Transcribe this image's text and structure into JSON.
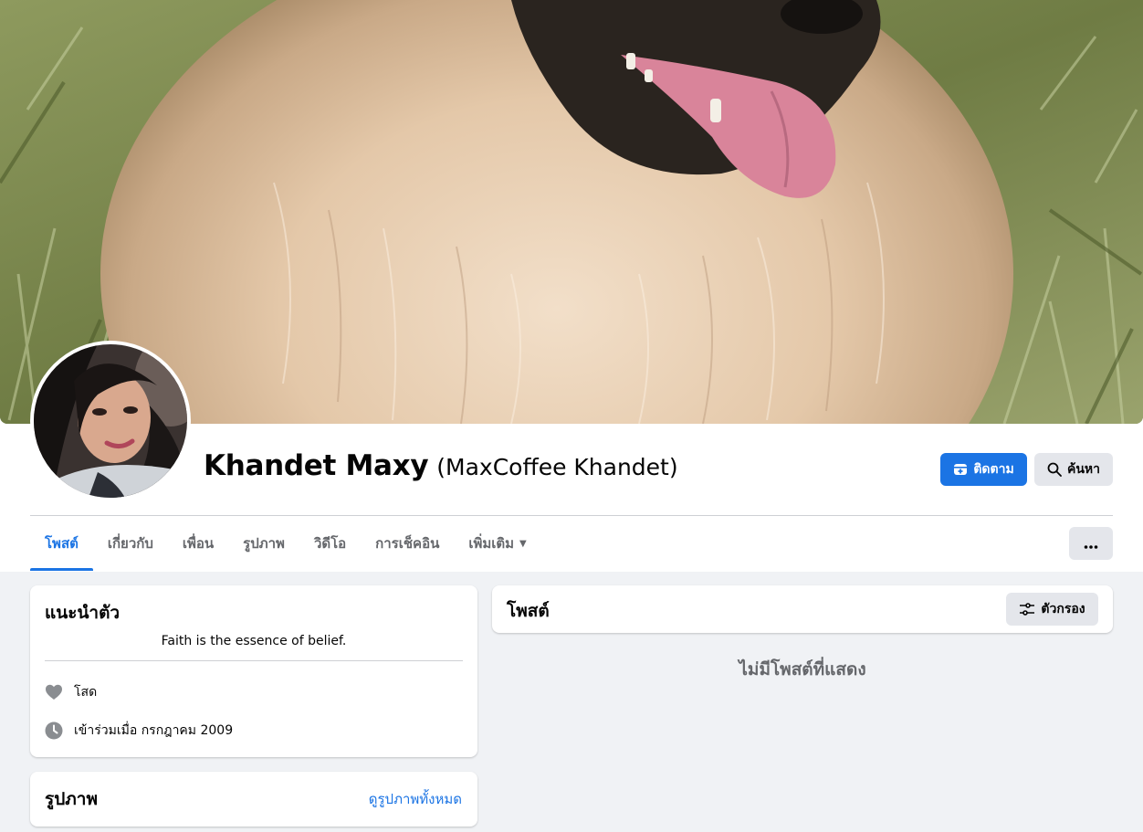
{
  "profile": {
    "name": "Khandet Maxy",
    "alternate_name": "(MaxCoffee Khandet)"
  },
  "header": {
    "follow_label": "ติดตาม",
    "search_label": "ค้นหา"
  },
  "tabs": [
    {
      "label": "โพสต์",
      "active": true
    },
    {
      "label": "เกี่ยวกับ"
    },
    {
      "label": "เพื่อน"
    },
    {
      "label": "รูปภาพ"
    },
    {
      "label": "วิดีโอ"
    },
    {
      "label": "การเช็คอิน"
    },
    {
      "label": "เพิ่มเติม"
    }
  ],
  "intro": {
    "title": "แนะนำตัว",
    "bio": "Faith is the essence of belief.",
    "relationship": "โสด",
    "joined": "เข้าร่วมเมื่อ กรกฎาคม 2009"
  },
  "photos": {
    "title": "รูปภาพ",
    "see_all_label": "ดูรูปภาพทั้งหมด"
  },
  "posts": {
    "title": "โพสต์",
    "filter_label": "ตัวกรอง",
    "empty_message": "ไม่มีโพสต์ที่แสดง"
  },
  "icons": {
    "follow": "follow-icon",
    "search": "search-icon",
    "more": "more-icon",
    "filter": "filter-icon",
    "relationship": "heart-icon",
    "joined": "clock-icon",
    "dropdown": "caret-down-icon"
  },
  "colors": {
    "accent": "#1b74e4",
    "secondary_button": "#e4e6eb",
    "page_background": "#f0f2f5",
    "secondary_text": "#65676b"
  }
}
